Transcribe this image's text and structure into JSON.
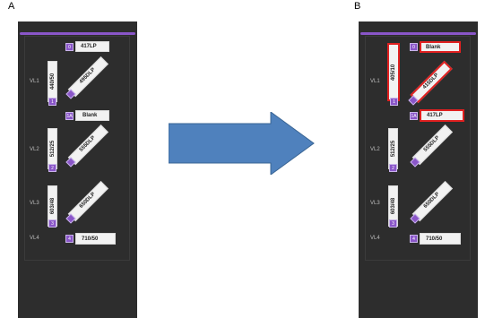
{
  "panels": {
    "a": {
      "letter": "A",
      "rows": [
        "VL1",
        "VL2",
        "VL3",
        "VL4"
      ],
      "items": {
        "top_num": "0",
        "top_label": "417LP",
        "v1_label": "440/50",
        "v1_num": "1",
        "d1_num": "A",
        "d1_label": "495DLP",
        "mid_num": "1A",
        "mid_label": "Blank",
        "v2_label": "512/25",
        "v2_num": "2",
        "d2_num": "B",
        "d2_label": "555DLP",
        "v3_label": "603/48",
        "v3_num": "3",
        "d3_num": "C",
        "d3_label": "650DLP",
        "bot_num": "4",
        "bot_label": "710/50"
      }
    },
    "b": {
      "letter": "B",
      "rows": [
        "VL1",
        "VL2",
        "VL3",
        "VL4"
      ],
      "items": {
        "top_num": "0",
        "top_label": "Blank",
        "v1_label": "405/10",
        "v1_num": "1",
        "d1_num": "A",
        "d1_label": "415DLP",
        "mid_num": "1A",
        "mid_label": "417LP",
        "v2_label": "512/25",
        "v2_num": "2",
        "d2_num": "B",
        "d2_label": "555DLP",
        "v3_label": "603/48",
        "v3_num": "3",
        "d3_num": "C",
        "d3_label": "650DLP",
        "bot_num": "4",
        "bot_label": "710/50"
      }
    }
  },
  "colors": {
    "panel_bg": "#2d2d2d",
    "accent_purple": "#8a56c8",
    "highlight_red": "#e02020",
    "arrow_blue": "#4f81bd"
  }
}
